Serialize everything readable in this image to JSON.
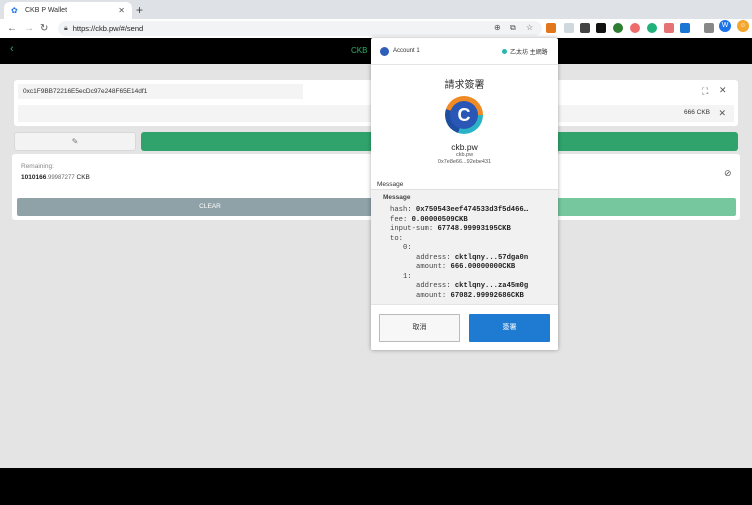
{
  "browser": {
    "tab_title": "CKB P Wallet",
    "url": "https://ckb.pw/#/send"
  },
  "app": {
    "title": "CKB",
    "to_address": "0xc1F9BB72216E5ecDc97e248F65E14df1",
    "amount": "666 CKB",
    "remaining_label": "Remaining:",
    "remaining_int": "1010166",
    "remaining_dec": ".99987277",
    "remaining_unit": "CKB",
    "clear_label": "CLEAR"
  },
  "metamask": {
    "account": "Account 1",
    "network": "乙太坊 主網路",
    "title": "請求簽署",
    "logo_letter": "C",
    "site": "ckb.pw",
    "site_sub": "ckb.pw",
    "site_addr": "0x7e8e66...92ebe431",
    "message_label": "Message",
    "message_header": "Message",
    "hash_key": "hash:",
    "hash_val": "0x750543eef474533d3f5d466…",
    "fee_key": "fee:",
    "fee_val": "0.00000509CKB",
    "input_key": "input-sum:",
    "input_val": "67748.99993195CKB",
    "to_key": "to:",
    "idx0": "0:",
    "addr_key": "address:",
    "addr0": "cktlqny...57dga0n",
    "amount_key": "amount:",
    "amount0": "666.00000000CKB",
    "idx1": "1:",
    "addr1": "cktlqny...za45m0g",
    "amount1": "67082.99992686CKB",
    "cancel_label": "取消",
    "sign_label": "簽署"
  },
  "icons": {
    "back": "back-arrow-icon",
    "forward": "forward-arrow-icon",
    "reload": "reload-icon",
    "lock": "lock-icon",
    "star": "star-icon",
    "fullscreen": "expand-icon",
    "close": "close-icon",
    "edit": "pencil-icon"
  },
  "colors": {
    "accent_green": "#2fa36b",
    "metamask_blue": "#1e7bd1",
    "clear_gray": "#8fa2a8"
  }
}
